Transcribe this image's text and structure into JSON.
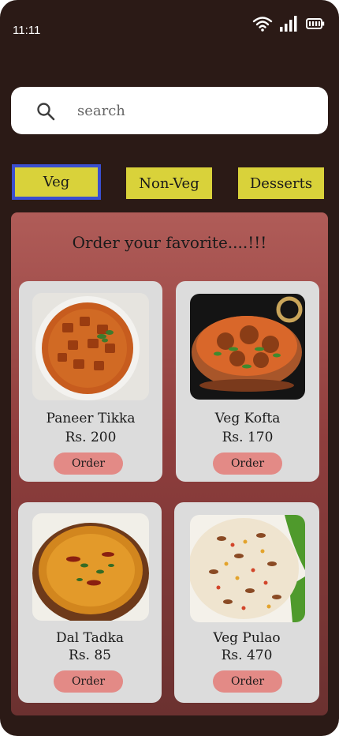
{
  "status": {
    "time": "11:11"
  },
  "search": {
    "placeholder": "search"
  },
  "tabs": [
    {
      "label": "Veg",
      "selected": true
    },
    {
      "label": "Non-Veg",
      "selected": false
    },
    {
      "label": "Desserts",
      "selected": false
    }
  ],
  "panel": {
    "title": "Order your favorite....!!!"
  },
  "items": [
    {
      "name": "Paneer Tikka",
      "price": "Rs. 200",
      "button": "Order"
    },
    {
      "name": "Veg Kofta",
      "price": "Rs. 170",
      "button": "Order"
    },
    {
      "name": "Dal Tadka",
      "price": "Rs. 85",
      "button": "Order"
    },
    {
      "name": "Veg Pulao",
      "price": "Rs. 470",
      "button": "Order"
    }
  ],
  "colors": {
    "background": "#2b1a16",
    "tab": "#d9d23a",
    "tab_selected_border": "#3a4fcf",
    "panel_top": "#b05c58",
    "panel_bottom": "#6b3130",
    "card": "#dcdcdc",
    "order_button": "#e38a86"
  },
  "icons": [
    "wifi-icon",
    "signal-icon",
    "battery-icon",
    "search-icon"
  ]
}
